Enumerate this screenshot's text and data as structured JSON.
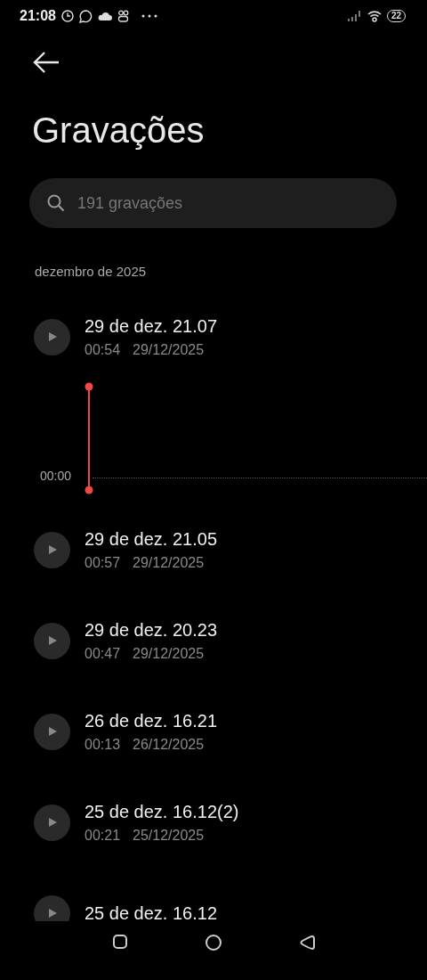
{
  "status_bar": {
    "time": "21:08",
    "battery": "22"
  },
  "title": "Gravações",
  "search": {
    "placeholder": "191 gravações"
  },
  "section": "dezembro de 2025",
  "recordings": [
    {
      "title": "29 de dez. 21.07",
      "duration": "00:54",
      "date": "29/12/2025",
      "expanded": true,
      "position": "00:00"
    },
    {
      "title": "29 de dez. 21.05",
      "duration": "00:57",
      "date": "29/12/2025",
      "expanded": false
    },
    {
      "title": "29 de dez. 20.23",
      "duration": "00:47",
      "date": "29/12/2025",
      "expanded": false
    },
    {
      "title": "26 de dez. 16.21",
      "duration": "00:13",
      "date": "26/12/2025",
      "expanded": false
    },
    {
      "title": "25 de dez. 16.12(2)",
      "duration": "00:21",
      "date": "25/12/2025",
      "expanded": false
    },
    {
      "title": "25 de dez. 16.12",
      "expanded": false
    }
  ]
}
